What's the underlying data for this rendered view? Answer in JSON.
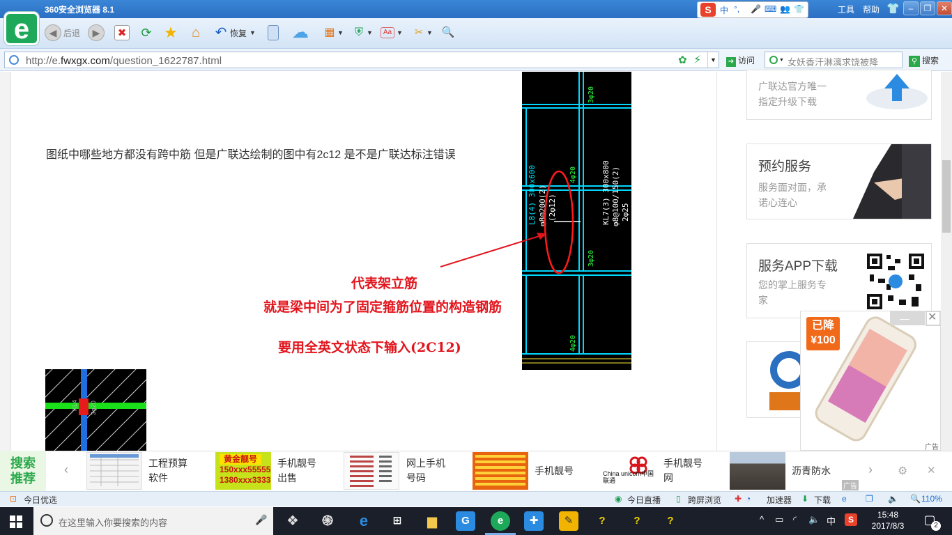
{
  "window": {
    "title": "360安全浏览器 8.1",
    "menu": [
      "工具",
      "帮助"
    ],
    "ime_lang": "中"
  },
  "toolbar": {
    "back_label": "后退",
    "restore_label": "恢复",
    "logo_glyph": "e"
  },
  "address": {
    "url_prefix": "http://e.",
    "url_domain": "fwxgx.com",
    "url_path": "/question_1622787.html",
    "go_label": "访问",
    "search_placeholder": "女妖香汗淋漓求饶被降",
    "search_label": "搜索"
  },
  "article": {
    "question": "图纸中哪些地方都没有跨中筋   但是广联达绘制的图中有2c12   是不是广联达标注错误",
    "annotation_1": "代表架立筋",
    "annotation_2": "就是梁中间为了固定箍筋位置的构造钢筋",
    "annotation_3": "要用全英文状态下输入(2C12)"
  },
  "sidebar": {
    "card1": {
      "line1": "广联达官方唯一",
      "line2": "指定升级下载"
    },
    "card2": {
      "title": "预约服务",
      "line1": "服务面对面，承",
      "line2": "诺心连心"
    },
    "card3": {
      "title": "服务APP下载",
      "line1": "您的掌上服务专",
      "line2": "家"
    }
  },
  "popup_ad": {
    "badge_1": "已降",
    "badge_2": "¥100",
    "tag": "广告"
  },
  "recommend": {
    "badge_1": "搜索",
    "badge_2": "推荐",
    "items": [
      {
        "l1": "工程预算",
        "l2": "软件"
      },
      {
        "l1": "手机靓号",
        "l2": "出售"
      },
      {
        "l1": "网上手机",
        "l2": "号码"
      },
      {
        "l1": "手机靓号",
        "l2": ""
      },
      {
        "l1": "手机靓号",
        "l2": "网"
      },
      {
        "l1": "沥青防水",
        "l2": ""
      }
    ],
    "thumb2_lines": [
      "黄金靓号",
      "150xxx55555",
      "1380xxx3333"
    ],
    "unicom_text": "China unicom中国联通",
    "ad_tag": "广告"
  },
  "statusbar": {
    "left": "今日优选",
    "live": "今日直播",
    "cross": "跨屏浏览",
    "accel": "加速器",
    "download": "下载",
    "zoom": "110%"
  },
  "taskbar": {
    "search_placeholder": "在这里输入你要搜索的内容",
    "time": "15:48",
    "date": "2017/8/3",
    "ime": "中",
    "notif_count": "2"
  },
  "colors": {
    "accent": "#2a6fc4",
    "annotation_red": "#e2141c",
    "cad_cyan": "#00e5ff",
    "cad_green": "#2bff3f"
  }
}
